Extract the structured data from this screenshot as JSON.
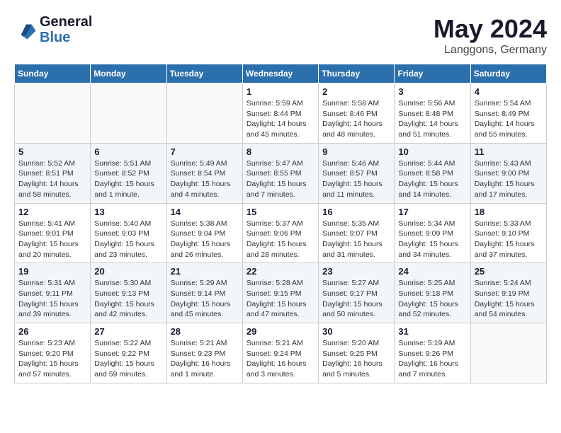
{
  "header": {
    "logo_line1": "General",
    "logo_line2": "Blue",
    "month": "May 2024",
    "location": "Langgons, Germany"
  },
  "weekdays": [
    "Sunday",
    "Monday",
    "Tuesday",
    "Wednesday",
    "Thursday",
    "Friday",
    "Saturday"
  ],
  "weeks": [
    [
      {
        "day": "",
        "info": ""
      },
      {
        "day": "",
        "info": ""
      },
      {
        "day": "",
        "info": ""
      },
      {
        "day": "1",
        "info": "Sunrise: 5:59 AM\nSunset: 8:44 PM\nDaylight: 14 hours and 45 minutes."
      },
      {
        "day": "2",
        "info": "Sunrise: 5:58 AM\nSunset: 8:46 PM\nDaylight: 14 hours and 48 minutes."
      },
      {
        "day": "3",
        "info": "Sunrise: 5:56 AM\nSunset: 8:48 PM\nDaylight: 14 hours and 51 minutes."
      },
      {
        "day": "4",
        "info": "Sunrise: 5:54 AM\nSunset: 8:49 PM\nDaylight: 14 hours and 55 minutes."
      }
    ],
    [
      {
        "day": "5",
        "info": "Sunrise: 5:52 AM\nSunset: 8:51 PM\nDaylight: 14 hours and 58 minutes."
      },
      {
        "day": "6",
        "info": "Sunrise: 5:51 AM\nSunset: 8:52 PM\nDaylight: 15 hours and 1 minute."
      },
      {
        "day": "7",
        "info": "Sunrise: 5:49 AM\nSunset: 8:54 PM\nDaylight: 15 hours and 4 minutes."
      },
      {
        "day": "8",
        "info": "Sunrise: 5:47 AM\nSunset: 8:55 PM\nDaylight: 15 hours and 7 minutes."
      },
      {
        "day": "9",
        "info": "Sunrise: 5:46 AM\nSunset: 8:57 PM\nDaylight: 15 hours and 11 minutes."
      },
      {
        "day": "10",
        "info": "Sunrise: 5:44 AM\nSunset: 8:58 PM\nDaylight: 15 hours and 14 minutes."
      },
      {
        "day": "11",
        "info": "Sunrise: 5:43 AM\nSunset: 9:00 PM\nDaylight: 15 hours and 17 minutes."
      }
    ],
    [
      {
        "day": "12",
        "info": "Sunrise: 5:41 AM\nSunset: 9:01 PM\nDaylight: 15 hours and 20 minutes."
      },
      {
        "day": "13",
        "info": "Sunrise: 5:40 AM\nSunset: 9:03 PM\nDaylight: 15 hours and 23 minutes."
      },
      {
        "day": "14",
        "info": "Sunrise: 5:38 AM\nSunset: 9:04 PM\nDaylight: 15 hours and 26 minutes."
      },
      {
        "day": "15",
        "info": "Sunrise: 5:37 AM\nSunset: 9:06 PM\nDaylight: 15 hours and 28 minutes."
      },
      {
        "day": "16",
        "info": "Sunrise: 5:35 AM\nSunset: 9:07 PM\nDaylight: 15 hours and 31 minutes."
      },
      {
        "day": "17",
        "info": "Sunrise: 5:34 AM\nSunset: 9:09 PM\nDaylight: 15 hours and 34 minutes."
      },
      {
        "day": "18",
        "info": "Sunrise: 5:33 AM\nSunset: 9:10 PM\nDaylight: 15 hours and 37 minutes."
      }
    ],
    [
      {
        "day": "19",
        "info": "Sunrise: 5:31 AM\nSunset: 9:11 PM\nDaylight: 15 hours and 39 minutes."
      },
      {
        "day": "20",
        "info": "Sunrise: 5:30 AM\nSunset: 9:13 PM\nDaylight: 15 hours and 42 minutes."
      },
      {
        "day": "21",
        "info": "Sunrise: 5:29 AM\nSunset: 9:14 PM\nDaylight: 15 hours and 45 minutes."
      },
      {
        "day": "22",
        "info": "Sunrise: 5:28 AM\nSunset: 9:15 PM\nDaylight: 15 hours and 47 minutes."
      },
      {
        "day": "23",
        "info": "Sunrise: 5:27 AM\nSunset: 9:17 PM\nDaylight: 15 hours and 50 minutes."
      },
      {
        "day": "24",
        "info": "Sunrise: 5:25 AM\nSunset: 9:18 PM\nDaylight: 15 hours and 52 minutes."
      },
      {
        "day": "25",
        "info": "Sunrise: 5:24 AM\nSunset: 9:19 PM\nDaylight: 15 hours and 54 minutes."
      }
    ],
    [
      {
        "day": "26",
        "info": "Sunrise: 5:23 AM\nSunset: 9:20 PM\nDaylight: 15 hours and 57 minutes."
      },
      {
        "day": "27",
        "info": "Sunrise: 5:22 AM\nSunset: 9:22 PM\nDaylight: 15 hours and 59 minutes."
      },
      {
        "day": "28",
        "info": "Sunrise: 5:21 AM\nSunset: 9:23 PM\nDaylight: 16 hours and 1 minute."
      },
      {
        "day": "29",
        "info": "Sunrise: 5:21 AM\nSunset: 9:24 PM\nDaylight: 16 hours and 3 minutes."
      },
      {
        "day": "30",
        "info": "Sunrise: 5:20 AM\nSunset: 9:25 PM\nDaylight: 16 hours and 5 minutes."
      },
      {
        "day": "31",
        "info": "Sunrise: 5:19 AM\nSunset: 9:26 PM\nDaylight: 16 hours and 7 minutes."
      },
      {
        "day": "",
        "info": ""
      }
    ]
  ]
}
